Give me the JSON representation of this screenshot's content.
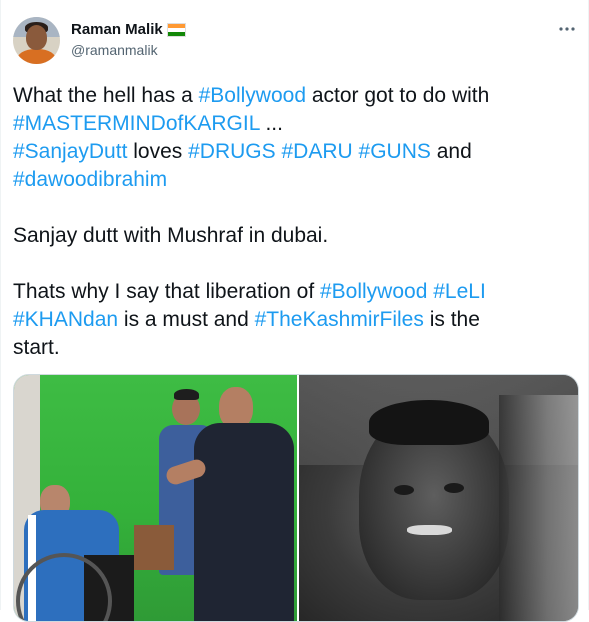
{
  "tweet": {
    "author_name": "Raman Malik",
    "author_handle": "@ramanmalik",
    "more_icon": "more-horizontal-icon",
    "flag_colors": [
      "#ff9933",
      "#ffffff",
      "#138808"
    ],
    "line1_a": "What the hell has a ",
    "line1_tag": "#Bollywood",
    "line1_b": " actor got to do with",
    "line2_tag": "#MASTERMINDofKARGIL",
    "line2_b": " ...",
    "line3_tag1": "#SanjayDutt",
    "line3_b": " loves ",
    "line3_tag2": "#DRUGS",
    "line3_sp1": " ",
    "line3_tag3": "#DARU",
    "line3_sp2": " ",
    "line3_tag4": "#GUNS",
    "line3_c": " and",
    "line4_tag": "#dawoodibrahim",
    "para2": "Sanjay dutt with Mushraf in dubai.",
    "para3_a": "Thats why I say that liberation of ",
    "para3_tag1": "#Bollywood",
    "para3_sp1": " ",
    "para3_tag2": "#LeLI",
    "para3_tag3": "#KHANdan",
    "para3_b": " is a must and ",
    "para3_tag4": "#TheKashmirFiles",
    "para3_c": " is the",
    "para3_d": "start.",
    "link_color": "#1d9bf0"
  }
}
